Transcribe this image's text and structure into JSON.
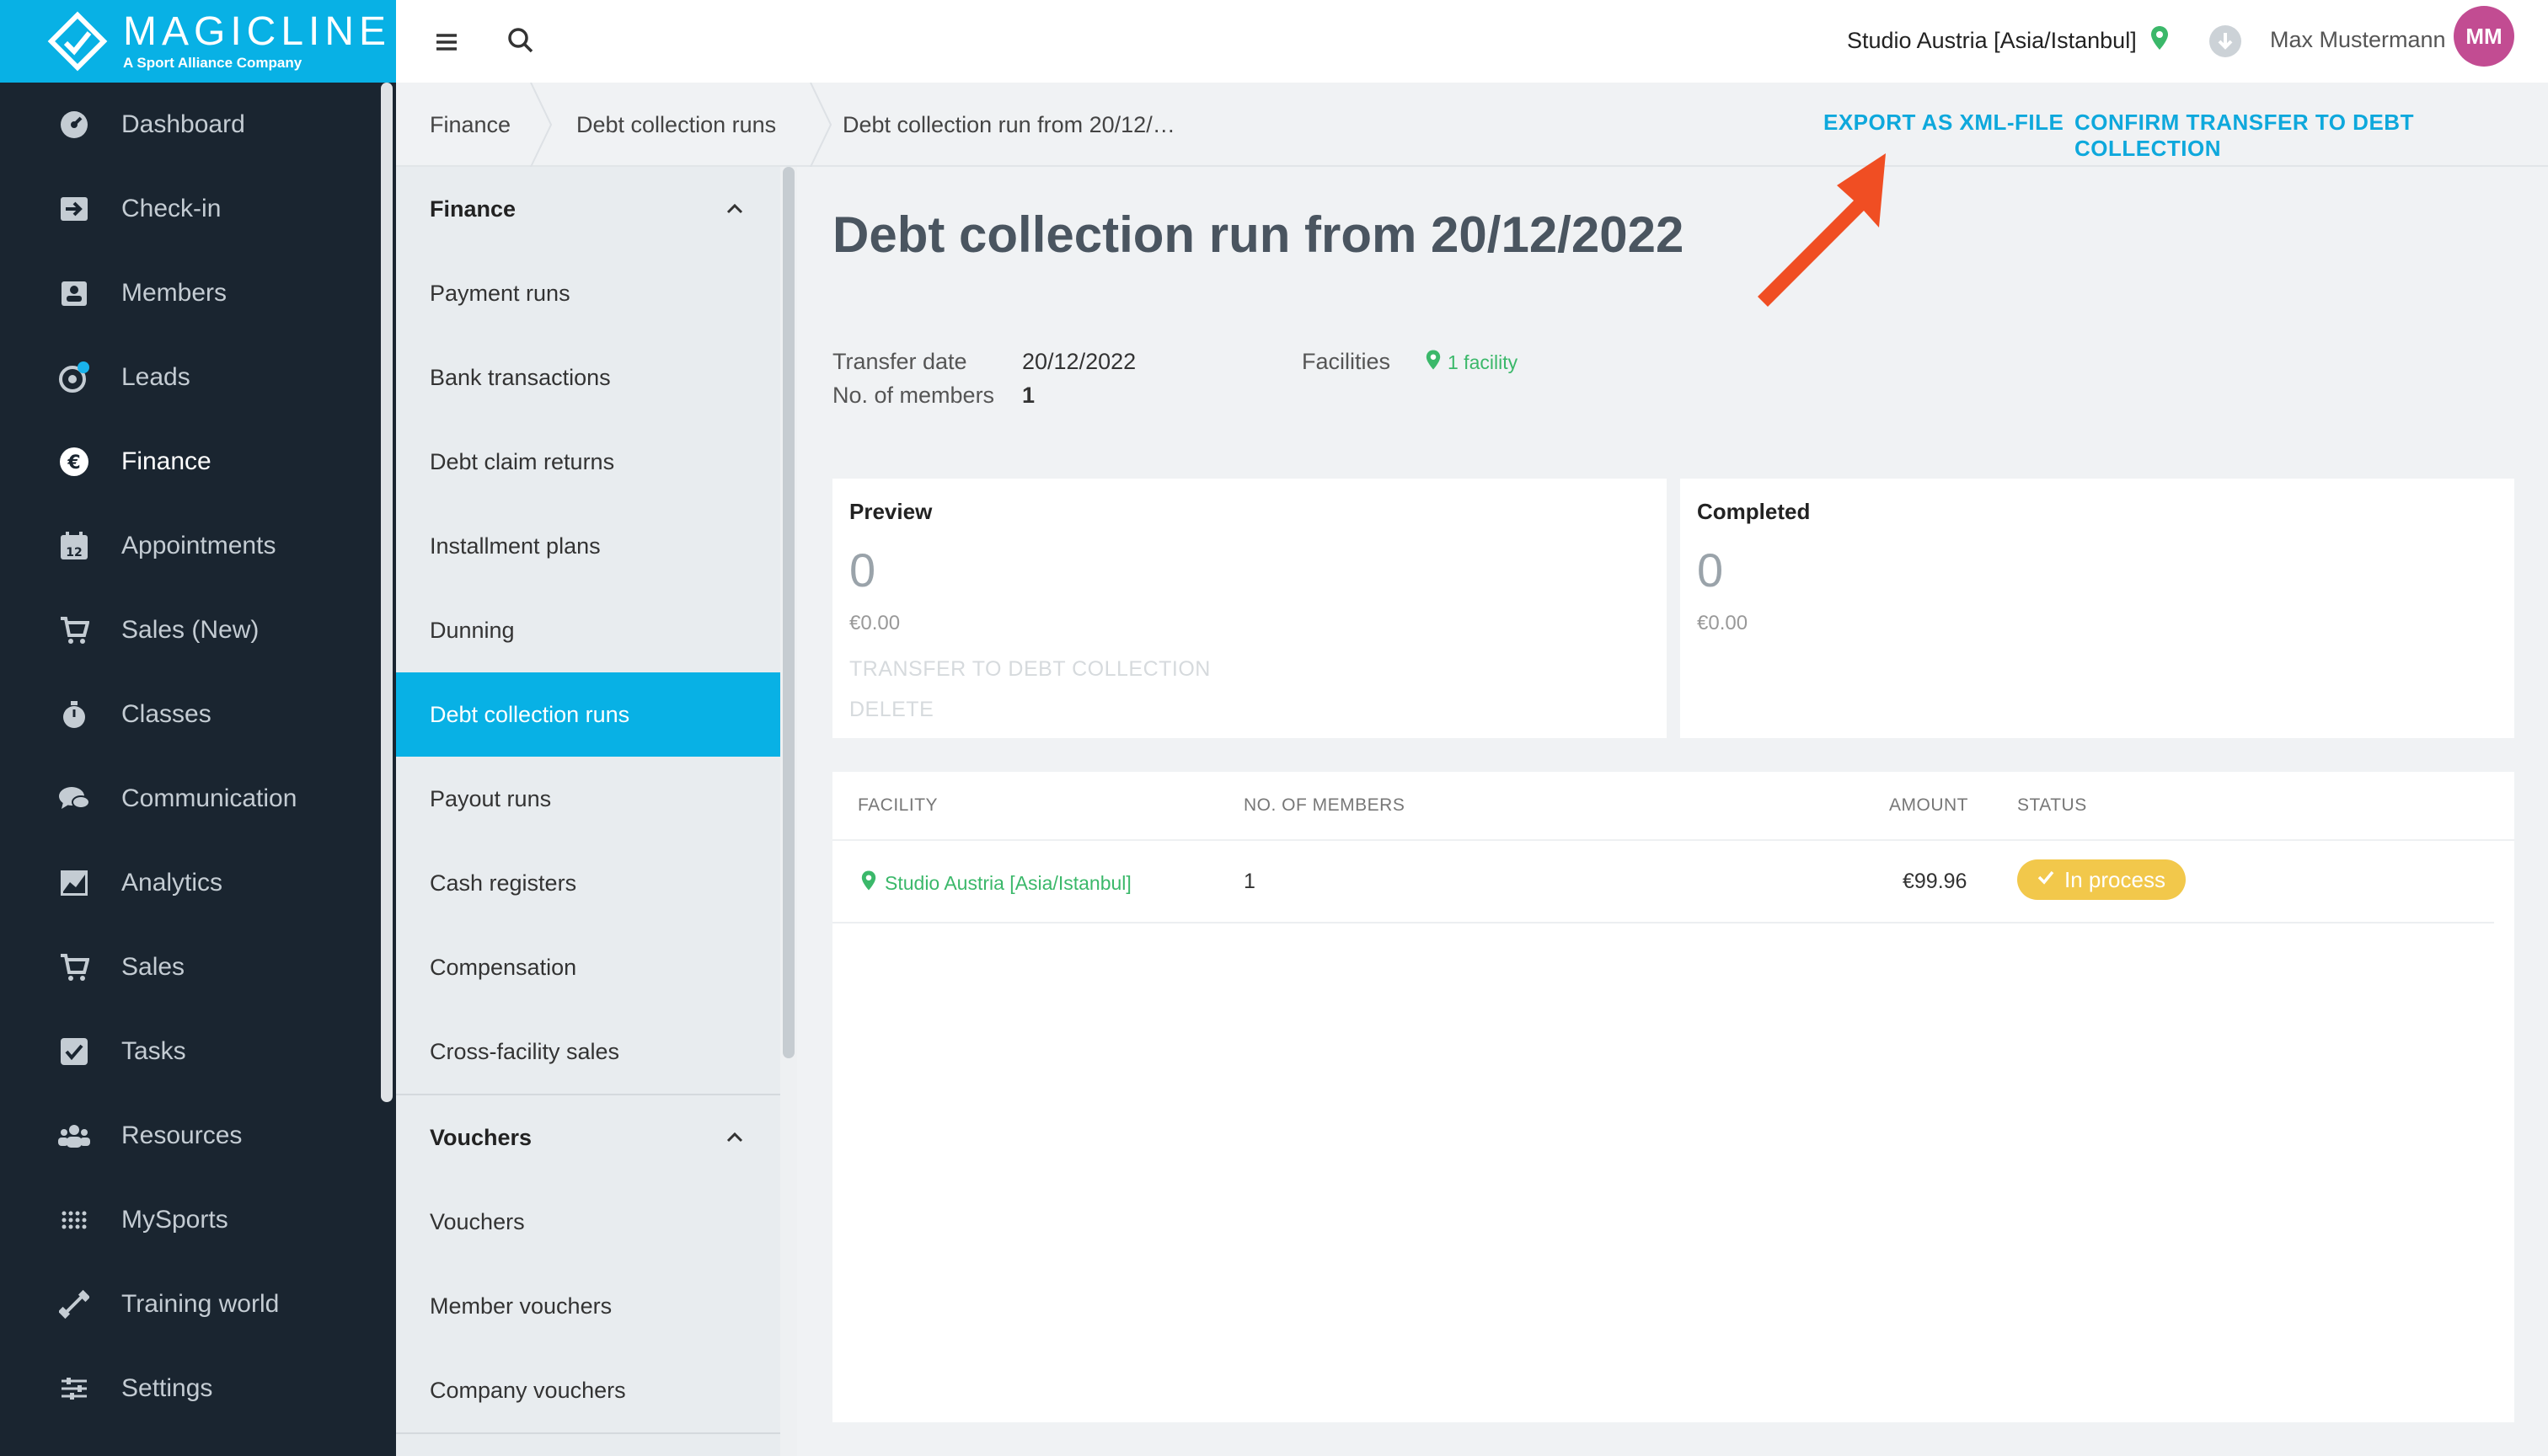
{
  "brand": {
    "name": "MAGICLINE",
    "sub": "A Sport Alliance Company",
    "color": "#08b1e5"
  },
  "nav": [
    {
      "label": "Dashboard",
      "icon": "dashboard-icon"
    },
    {
      "label": "Check-in",
      "icon": "check-in-icon"
    },
    {
      "label": "Members",
      "icon": "members-icon"
    },
    {
      "label": "Leads",
      "icon": "leads-icon"
    },
    {
      "label": "Finance",
      "icon": "euro-icon",
      "active": true
    },
    {
      "label": "Appointments",
      "icon": "calendar-icon"
    },
    {
      "label": "Sales (New)",
      "icon": "cart-icon"
    },
    {
      "label": "Classes",
      "icon": "stopwatch-icon"
    },
    {
      "label": "Communication",
      "icon": "chat-icon"
    },
    {
      "label": "Analytics",
      "icon": "chart-icon"
    },
    {
      "label": "Sales",
      "icon": "cart-icon"
    },
    {
      "label": "Tasks",
      "icon": "checkbox-icon"
    },
    {
      "label": "Resources",
      "icon": "people-icon"
    },
    {
      "label": "MySports",
      "icon": "dots-icon"
    },
    {
      "label": "Training world",
      "icon": "dumbbell-icon"
    },
    {
      "label": "Settings",
      "icon": "sliders-icon"
    }
  ],
  "topbar": {
    "studio": "Studio Austria [Asia/Istanbul]",
    "user": "Max Mustermann",
    "initials": "MM"
  },
  "breadcrumb": [
    "Finance",
    "Debt collection runs",
    "Debt collection run from 20/12/…"
  ],
  "actions": {
    "export": "EXPORT AS XML-FILE",
    "confirm": "CONFIRM TRANSFER TO DEBT COLLECTION"
  },
  "subnav": {
    "finance_head": "Finance",
    "finance_items": [
      "Payment runs",
      "Bank transactions",
      "Debt claim returns",
      "Installment plans",
      "Dunning",
      "Debt collection runs",
      "Payout runs",
      "Cash registers",
      "Compensation",
      "Cross-facility sales"
    ],
    "active": "Debt collection runs",
    "vouchers_head": "Vouchers",
    "voucher_items": [
      "Vouchers",
      "Member vouchers",
      "Company vouchers"
    ]
  },
  "page": {
    "title": "Debt collection run from 20/12/2022",
    "transfer_date_label": "Transfer date",
    "transfer_date": "20/12/2022",
    "members_label": "No. of members",
    "members": "1",
    "facilities_label": "Facilities",
    "facilities": "1 facility"
  },
  "cards": {
    "preview": {
      "title": "Preview",
      "count": "0",
      "amount": "€0.00",
      "transfer": "TRANSFER TO DEBT COLLECTION",
      "delete": "DELETE"
    },
    "completed": {
      "title": "Completed",
      "count": "0",
      "amount": "€0.00"
    }
  },
  "table": {
    "headers": {
      "facility": "FACILITY",
      "members": "NO. OF MEMBERS",
      "amount": "AMOUNT",
      "status": "STATUS"
    },
    "rows": [
      {
        "facility": "Studio Austria [Asia/Istanbul]",
        "members": "1",
        "amount": "€99.96",
        "status": "In process"
      }
    ]
  },
  "colors": {
    "accent": "#08b1e5",
    "link": "#0ea8dc",
    "green": "#3bb86a",
    "status": "#f2c84b",
    "avatar": "#c24c92",
    "arrow": "#f04e23"
  }
}
